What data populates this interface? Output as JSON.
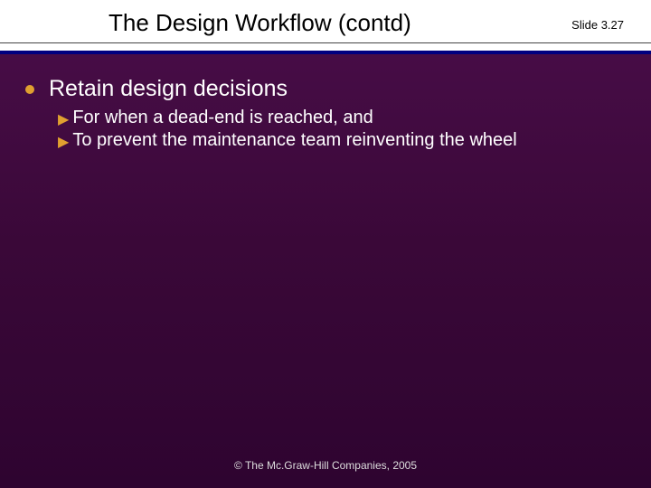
{
  "header": {
    "title": "The Design Workflow (contd)",
    "slide_number": "Slide 3.27"
  },
  "content": {
    "bullet": "Retain design decisions",
    "sub_items": [
      "For when a dead-end is reached, and",
      "To prevent the maintenance team reinventing the wheel"
    ]
  },
  "footer": {
    "copyright": "© The Mc.Graw-Hill Companies, 2005"
  }
}
